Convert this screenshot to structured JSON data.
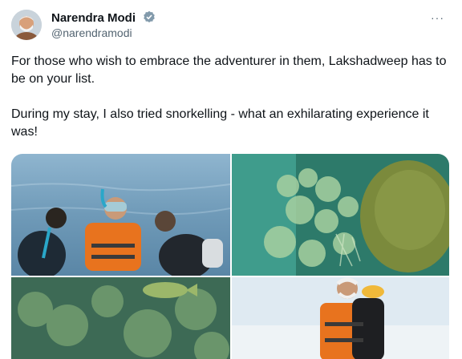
{
  "tweet": {
    "author_name": "Narendra Modi",
    "author_handle": "@narendramodi",
    "verified_icon": "verified-badge-icon",
    "more_label": "···",
    "paragraph1": "For those who wish to embrace the adventurer in them, Lakshadweep has to be on your list.",
    "paragraph2": "During my stay, I also tried snorkelling - what an exhilarating experience it was!"
  },
  "media": {
    "photos": [
      "snorkelling-group-photo",
      "coral-reef-photo",
      "underwater-coral-fish-photo",
      "man-in-life-jacket-photo"
    ]
  },
  "colors": {
    "text_primary": "#0f1419",
    "text_secondary": "#536471",
    "verified_badge": "#829aab"
  }
}
